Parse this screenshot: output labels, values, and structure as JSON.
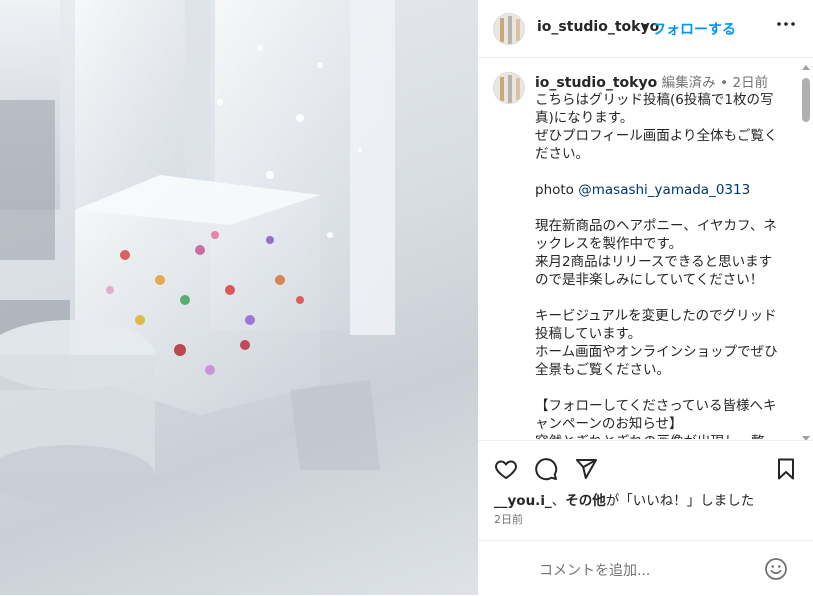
{
  "header": {
    "username": "io_studio_tokyo",
    "separator": "•",
    "follow_label": "フォローする",
    "more_label": "•••"
  },
  "caption": {
    "username": "io_studio_tokyo",
    "edited_label": "編集済み",
    "separator": "•",
    "time": "2日前",
    "text_intro": "こちらはグリッド投稿(6投稿で1枚の写真)になります。\nぜひプロフィール画面より全体もご覧ください。\n\nphoto ",
    "mention": "@masashi_yamada_0313",
    "text_body": "\n\n現在新商品のヘアポニー、イヤカフ、ネックレスを製作中です。\n来月2商品はリリースできると思いますので是非楽しみにしていてください！\n\nキービジュアルを変更したのでグリッド投稿しています。\nホーム画面やオンラインショップでぜひ全景もご覧ください。\n\n【フォローしてくださっている皆様へキャンペーンのお知らせ】\n突然とぎれとぎれの画像が出現し、整"
  },
  "likes": {
    "user": "__you.i_",
    "separator": "、",
    "others": "その他",
    "suffix": "が「いいね！」しました"
  },
  "date": "2日前",
  "comment": {
    "placeholder": "コメントを追加..."
  },
  "icons": {
    "like": "heart-icon",
    "comment": "comment-icon",
    "share": "share-icon",
    "save": "bookmark-icon",
    "emoji": "emoji-icon",
    "more": "more-icon"
  },
  "colors": {
    "link": "#0095f6",
    "mention": "#00376b",
    "text": "#262626",
    "muted": "#737373"
  }
}
